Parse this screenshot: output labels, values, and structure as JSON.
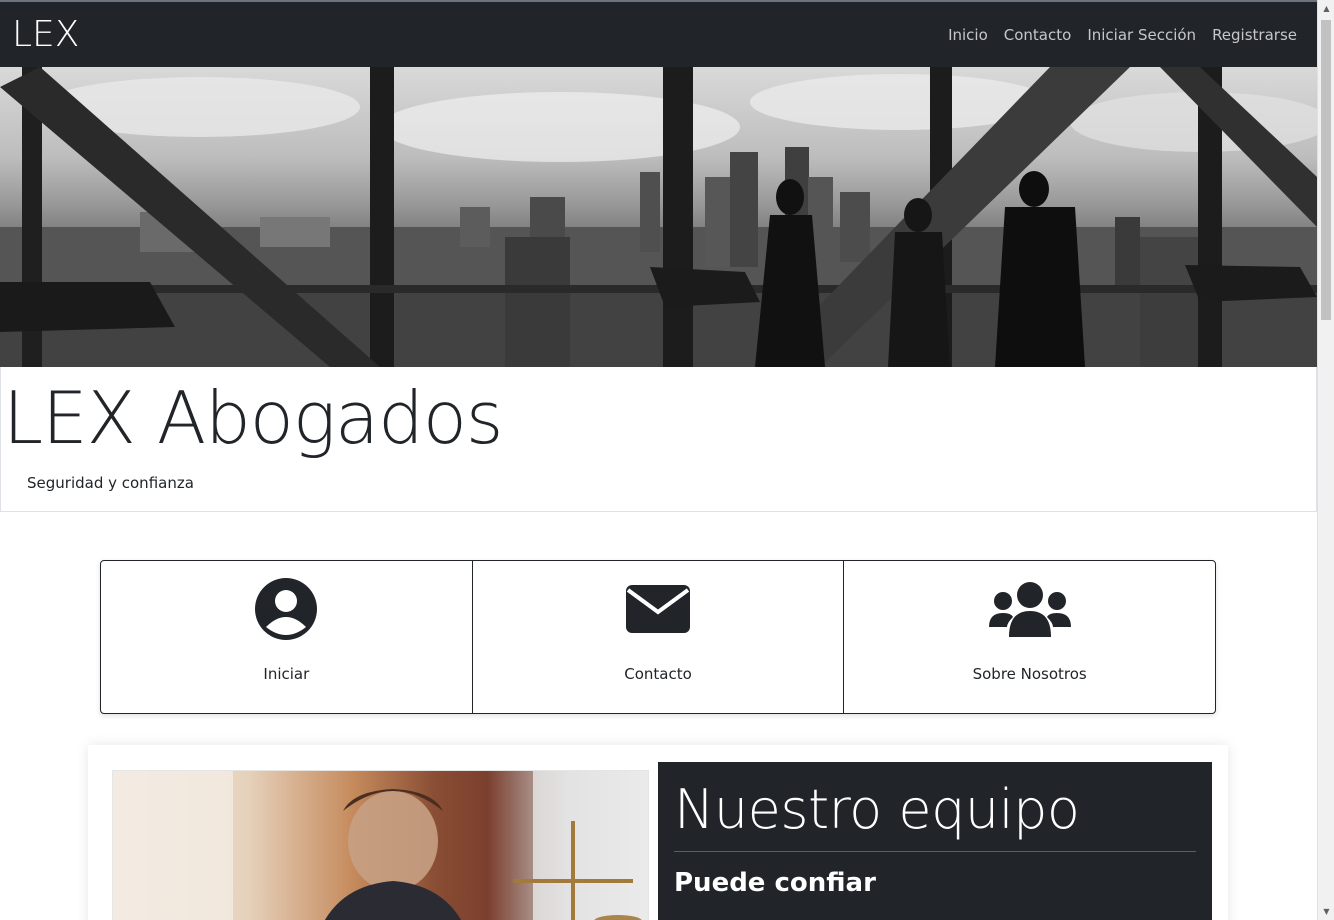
{
  "navbar": {
    "brand": "LEX",
    "links": [
      "Inicio",
      "Contacto",
      "Iniciar Sección",
      "Registrarse"
    ]
  },
  "header": {
    "title": "LEX Abogados",
    "tagline": "Seguridad y confianza"
  },
  "cards": [
    {
      "label": "Iniciar",
      "icon": "user-circle-icon"
    },
    {
      "label": "Contacto",
      "icon": "envelope-icon"
    },
    {
      "label": "Sobre Nosotros",
      "icon": "users-icon"
    }
  ],
  "team": {
    "title": "Nuestro equipo",
    "subtitle": "Puede confiar"
  },
  "colors": {
    "navbar_bg": "#212529",
    "text": "#212529",
    "nav_link": "#c5c7c9"
  }
}
